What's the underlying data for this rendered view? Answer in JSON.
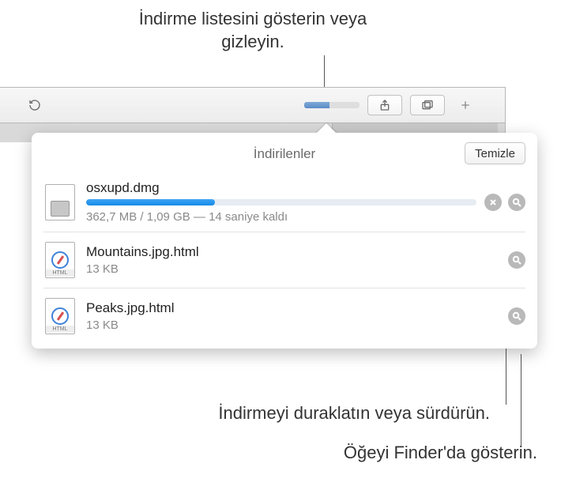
{
  "callouts": {
    "top": "İndirme listesini gösterin veya gizleyin.",
    "mid": "İndirmeyi duraklatın veya sürdürün.",
    "bottom": "Öğeyi Finder'da gösterin."
  },
  "popover": {
    "title": "İndirilenler",
    "clear_label": "Temizle"
  },
  "downloads": [
    {
      "name": "osxupd.dmg",
      "type": "dmg",
      "in_progress": true,
      "progress_percent": 33,
      "status": "362,7 MB / 1,09 GB — 14 saniye kaldı"
    },
    {
      "name": "Mountains.jpg.html",
      "type": "html",
      "in_progress": false,
      "status": "13 KB"
    },
    {
      "name": "Peaks.jpg.html",
      "type": "html",
      "in_progress": false,
      "status": "13 KB"
    }
  ],
  "icons": {
    "html_label": "HTML"
  },
  "toolbar": {
    "download_progress_percent": 45
  }
}
